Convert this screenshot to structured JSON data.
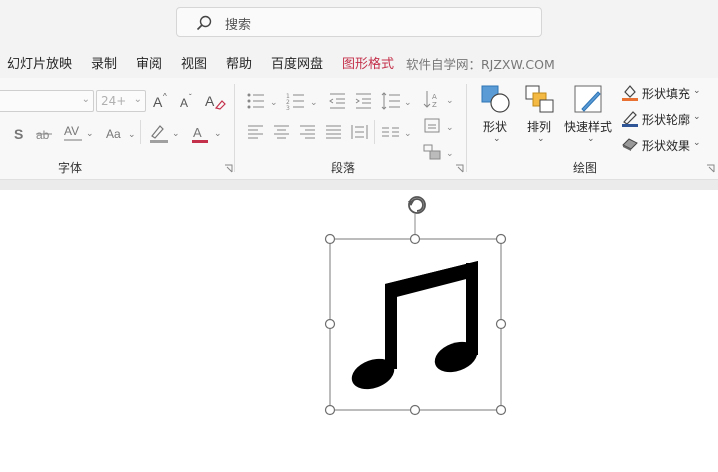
{
  "search": {
    "label": "搜索"
  },
  "tabs": [
    {
      "label": "幻灯片放映"
    },
    {
      "label": "录制"
    },
    {
      "label": "审阅"
    },
    {
      "label": "视图"
    },
    {
      "label": "帮助"
    },
    {
      "label": "百度网盘"
    },
    {
      "label": "图形格式",
      "active": true
    }
  ],
  "watermark": "软件自学网：RJZXW.COM",
  "ribbon": {
    "font_group": {
      "label": "字体",
      "font_size": "24+"
    },
    "paragraph_group": {
      "label": "段落"
    },
    "drawing_group": {
      "label": "绘图",
      "shapes": "形状",
      "arrange": "排列",
      "quick_styles": "快速样式",
      "shape_fill": "形状填充",
      "shape_outline": "形状轮廓",
      "shape_effects": "形状效果"
    }
  },
  "colors": {
    "accent": "#c4314b",
    "fill_bar": "#e97132",
    "outline_bar": "#2f5597",
    "highlight_bar": "#a0a0a0"
  },
  "slide": {
    "shape_icon": "music-note-icon",
    "selected": true
  }
}
